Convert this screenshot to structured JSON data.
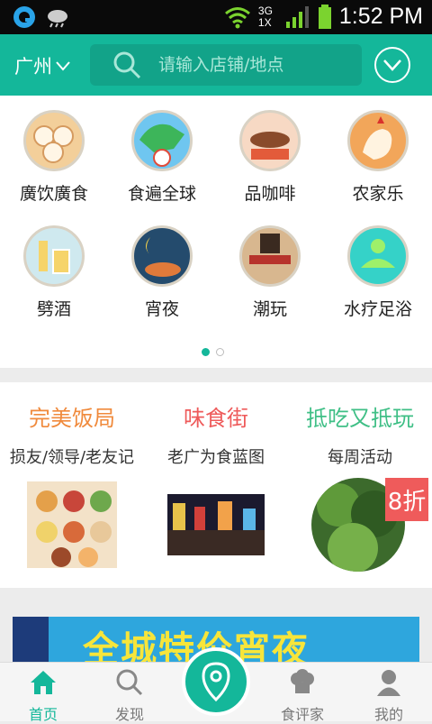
{
  "status_bar": {
    "time": "1:52 PM",
    "network": "3G 1X"
  },
  "header": {
    "city": "广州",
    "search_placeholder": "请输入店铺/地点",
    "accent": "#14b79a"
  },
  "categories": [
    {
      "label": "廣饮廣食",
      "icon": "dim-sum-icon"
    },
    {
      "label": "食遍全球",
      "icon": "globe-food-icon"
    },
    {
      "label": "品咖啡",
      "icon": "coffee-icon"
    },
    {
      "label": "农家乐",
      "icon": "rooster-icon"
    },
    {
      "label": "劈酒",
      "icon": "beer-icon"
    },
    {
      "label": "宵夜",
      "icon": "night-snack-icon"
    },
    {
      "label": "潮玩",
      "icon": "trendy-play-icon"
    },
    {
      "label": "水疗足浴",
      "icon": "spa-icon"
    }
  ],
  "pager": {
    "pages": 2,
    "current": 1
  },
  "promos": [
    {
      "title": "完美饭局",
      "subtitle": "损友/领导/老友记",
      "color": "#f08a3c"
    },
    {
      "title": "味食街",
      "subtitle": "老广为食蓝图",
      "color": "#ee5a5a"
    },
    {
      "title": "抵吃又抵玩",
      "subtitle": "每周活动",
      "color": "#3fbf86",
      "badge": "8折"
    }
  ],
  "banner": {
    "text": "全城特价宵夜"
  },
  "tabs": [
    {
      "label": "首页",
      "icon": "home-icon",
      "active": true
    },
    {
      "label": "发现",
      "icon": "discover-search-icon",
      "active": false
    },
    {
      "label": "",
      "icon": "location-pin-icon",
      "active": false
    },
    {
      "label": "食评家",
      "icon": "chef-hat-icon",
      "active": false
    },
    {
      "label": "我的",
      "icon": "user-icon",
      "active": false
    }
  ]
}
